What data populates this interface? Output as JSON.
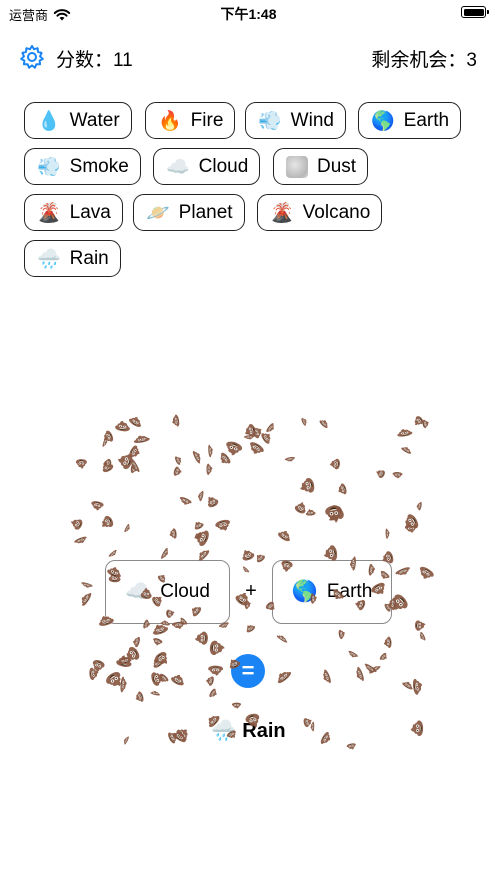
{
  "status_bar": {
    "carrier": "运营商",
    "time": "下午1:48"
  },
  "header": {
    "settings_icon": "gear-icon",
    "score_text": "分数：11",
    "chances_text": "剩余机会：3"
  },
  "elements": [
    {
      "emoji": "💧",
      "label": "Water"
    },
    {
      "emoji": "🔥",
      "label": "Fire"
    },
    {
      "emoji": "💨",
      "label": "Wind"
    },
    {
      "emoji": "🌎",
      "label": "Earth"
    },
    {
      "emoji": "💨",
      "label": "Smoke"
    },
    {
      "emoji": "☁️",
      "label": "Cloud"
    },
    {
      "emoji": "",
      "label": "Dust"
    },
    {
      "emoji": "🌋",
      "label": "Lava"
    },
    {
      "emoji": "🪐",
      "label": "Planet"
    },
    {
      "emoji": "🌋",
      "label": "Volcano"
    },
    {
      "emoji": "🌧️",
      "label": "Rain"
    }
  ],
  "combine": {
    "left": {
      "emoji": "☁️",
      "label": "Cloud"
    },
    "operator": "+",
    "right": {
      "emoji": "🌎",
      "label": "Earth"
    },
    "equals": "=",
    "result": {
      "emoji": "🌧️",
      "label": "Rain"
    }
  },
  "particle_icon": "poop-emoji",
  "particle_glyph": "💩",
  "colors": {
    "accent": "#1a84f5",
    "chip_border": "#222222",
    "slot_border": "#8a8a8a"
  }
}
